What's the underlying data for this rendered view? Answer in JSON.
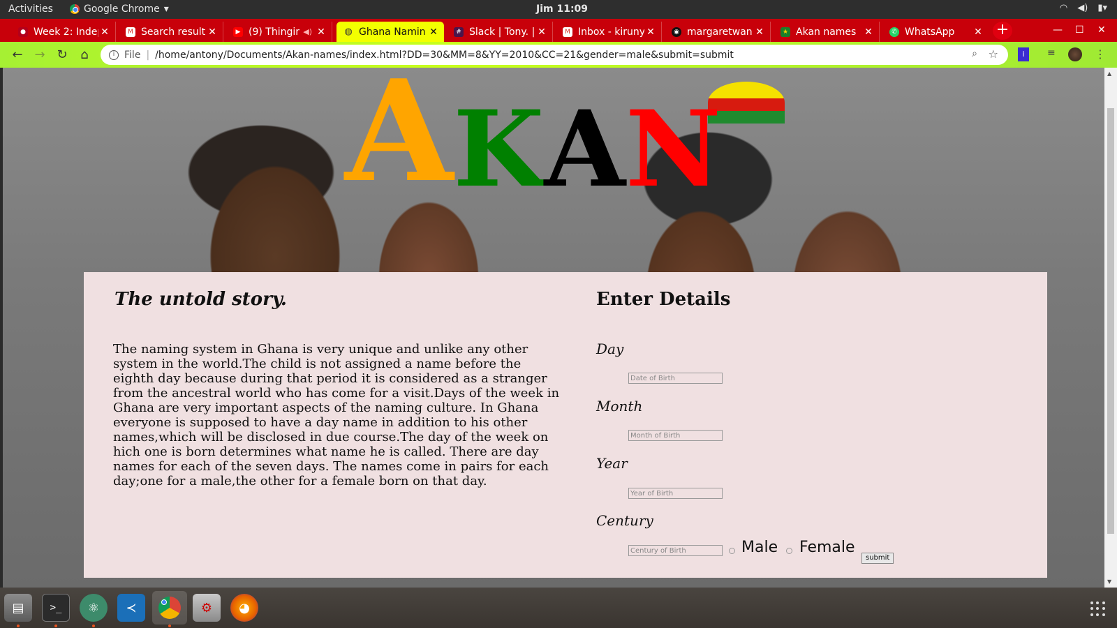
{
  "topbar": {
    "activities": "Activities",
    "app_name": "Google Chrome",
    "clock": "Jim 11:09"
  },
  "tabs": [
    {
      "title": "Week 2: Indep",
      "favicon": "moringa-icon",
      "active": false
    },
    {
      "title": "Search result",
      "favicon": "gmail-icon",
      "active": false
    },
    {
      "title": "(9) Thingir",
      "favicon": "youtube-icon",
      "active": false,
      "audio": true
    },
    {
      "title": "Ghana Namin",
      "favicon": "globe-icon",
      "active": true
    },
    {
      "title": "Slack | Tony. |",
      "favicon": "slack-icon",
      "active": false
    },
    {
      "title": "Inbox - kiruny",
      "favicon": "gmail-icon",
      "active": false
    },
    {
      "title": "margaretwan",
      "favicon": "github-icon",
      "active": false
    },
    {
      "title": "Akan names",
      "favicon": "star-icon",
      "active": false
    },
    {
      "title": "WhatsApp",
      "favicon": "whatsapp-icon",
      "active": false
    }
  ],
  "omnibox": {
    "scheme_label": "File",
    "url": "/home/antony/Documents/Akan-names/index.html?DD=30&MM=8&YY=2010&CC=21&gender=male&submit=submit"
  },
  "page": {
    "logo": [
      "A",
      "K",
      "A",
      "N"
    ],
    "logo_colors": [
      "#ffa500",
      "#008000",
      "#000000",
      "#ff0000"
    ],
    "story_heading": "The untold story.",
    "story_text": "The naming system in Ghana is very unique and unlike any other system in the world.The child is not assigned a name before the eighth day because during that period it is considered as a stranger from the ancestral world who has come for a visit.Days of the week in Ghana are very important aspects of the naming culture. In Ghana everyone is supposed to have a day name in addition to his other names,which will be disclosed in due course.The day of the week on hich one is born determines what name he is called. There are day names for each of the seven days. The names come in pairs for each day;one for a male,the other for a female born on that day.",
    "details_heading": "Enter Details",
    "fields": [
      {
        "label": "Day",
        "placeholder": "Date of Birth",
        "value": ""
      },
      {
        "label": "Month",
        "placeholder": "Month of Birth",
        "value": ""
      },
      {
        "label": "Year",
        "placeholder": "Year of Birth",
        "value": ""
      },
      {
        "label": "Century",
        "placeholder": "Century of Birth",
        "value": ""
      }
    ],
    "gender": {
      "male_label": "Male",
      "female_label": "Female"
    },
    "submit_label": "submit"
  },
  "dock": [
    "files-icon",
    "terminal-icon",
    "atom-icon",
    "vscode-icon",
    "chrome-icon",
    "settings-icon",
    "firefox-icon"
  ]
}
